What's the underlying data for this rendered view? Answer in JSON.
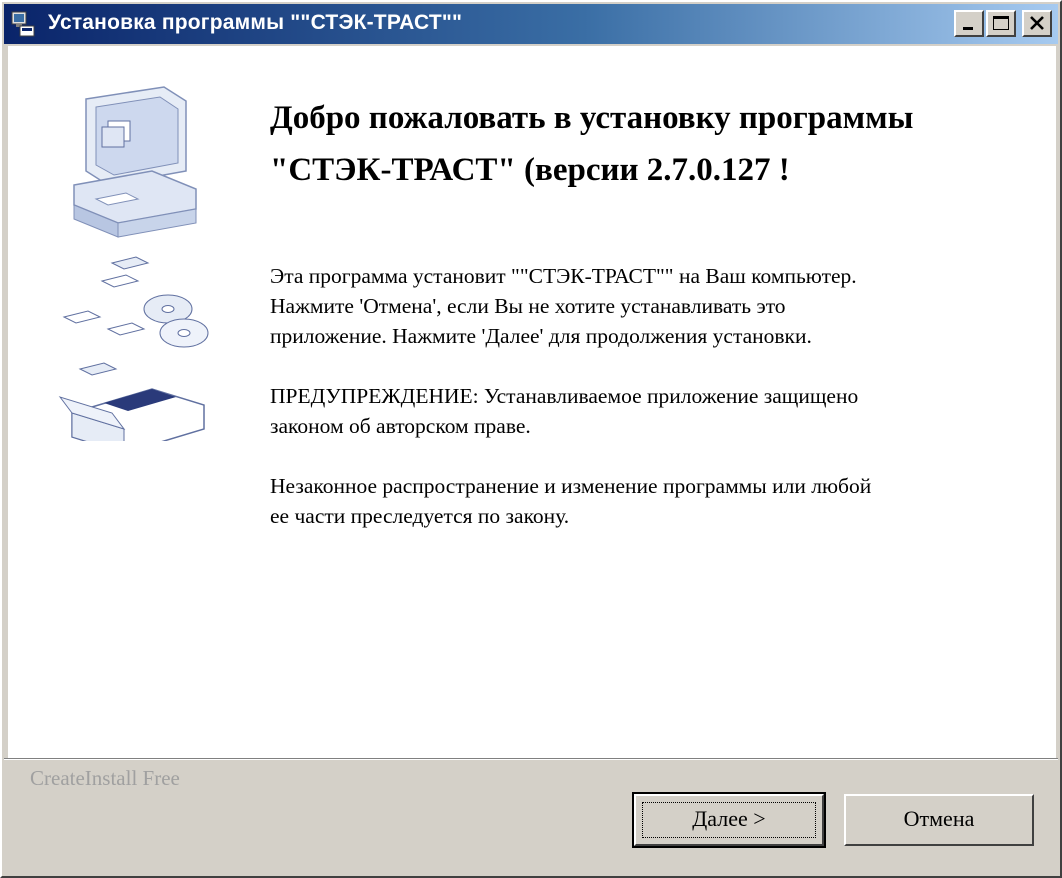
{
  "window": {
    "title": "Установка программы \"\"СТЭК-ТРАСТ\"\"",
    "controls": {
      "minimize": "minimize-icon",
      "maximize": "maximize-icon",
      "close": "close-icon"
    }
  },
  "welcome": {
    "title": "Добро пожаловать в установку программы \"СТЭК-ТРАСТ\" (версии 2.7.0.127 !",
    "paragraph1": [
      "Эта программа установит \"\"СТЭК-ТРАСТ\"\" на Ваш компьютер.",
      "Нажмите 'Отмена', если Вы не хотите устанавливать это",
      "приложение. Нажмите 'Далее' для продолжения установки."
    ],
    "paragraph2": [
      "ПРЕДУПРЕЖДЕНИЕ: Устанавливаемое приложение защищено",
      "законом об авторском праве."
    ],
    "paragraph3": [
      "Незаконное распространение и изменение программы или любой",
      "ее части преследуется по закону."
    ]
  },
  "footer": {
    "brand": "CreateInstall Free",
    "next_label": "Далее >",
    "cancel_label": "Отмена"
  },
  "colors": {
    "titlebar_start": "#0a246a",
    "titlebar_end": "#a6caf0",
    "face": "#d4d0c8"
  },
  "icons": [
    "installer-app-icon",
    "computer-disks-illustration"
  ]
}
